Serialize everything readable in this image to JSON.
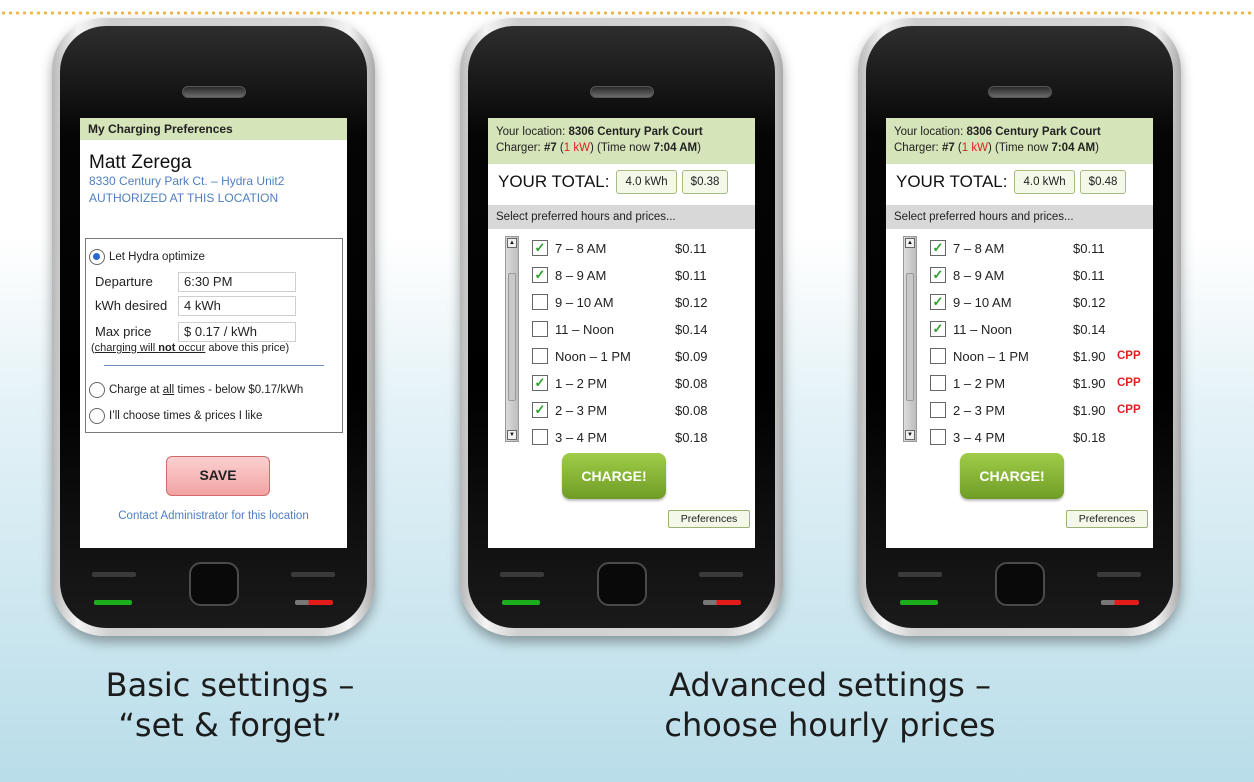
{
  "phone1": {
    "header": "My Charging Preferences",
    "user_name": "Matt Zerega",
    "address": "8330 Century Park Ct. – Hydra Unit2",
    "auth_status": "AUTHORIZED AT THIS LOCATION",
    "option_optimize": "Let Hydra optimize",
    "departure_label": "Departure",
    "departure_value": "6:30 PM",
    "kwh_label": "kWh desired",
    "kwh_value": "4 kWh",
    "maxprice_label": "Max price",
    "maxprice_value": "$ 0.17 / kWh",
    "note_part1": "charging will ",
    "note_part2": "not",
    "note_part3": " occur",
    "note_part4": " above this price)",
    "option_all_pre": "Charge at ",
    "option_all_u": "all",
    "option_all_post": " times - below $0.17/kWh",
    "option_choose": "I’ll choose times & prices I like",
    "save_label": "SAVE",
    "contact_link": "Contact Administrator for this location"
  },
  "phone2": {
    "loc_prefix": "Your location: ",
    "loc_value": "8306 Century Park Court",
    "charger_prefix": "Charger: ",
    "charger_value": "#7",
    "charger_kw": "1 kW",
    "time_prefix": "(Time now ",
    "time_value": "7:04 AM",
    "total_label": "YOUR TOTAL:",
    "total_kwh": "4.0 kWh",
    "total_price": "$0.38",
    "select_prompt": "Select preferred hours and prices...",
    "hours": [
      {
        "label": "7 – 8 AM",
        "price": "$0.11",
        "checked": true,
        "tag": ""
      },
      {
        "label": "8 – 9 AM",
        "price": "$0.11",
        "checked": true,
        "tag": ""
      },
      {
        "label": "9 – 10 AM",
        "price": "$0.12",
        "checked": false,
        "tag": ""
      },
      {
        "label": "11 – Noon",
        "price": "$0.14",
        "checked": false,
        "tag": ""
      },
      {
        "label": "Noon – 1 PM",
        "price": "$0.09",
        "checked": false,
        "tag": ""
      },
      {
        "label": "1 – 2 PM",
        "price": "$0.08",
        "checked": true,
        "tag": ""
      },
      {
        "label": "2 – 3 PM",
        "price": "$0.08",
        "checked": true,
        "tag": ""
      },
      {
        "label": "3 – 4 PM",
        "price": "$0.18",
        "checked": false,
        "tag": ""
      }
    ],
    "charge_label": "CHARGE!",
    "pref_label": "Preferences"
  },
  "phone3": {
    "loc_prefix": "Your location: ",
    "loc_value": "8306 Century Park Court",
    "charger_prefix": "Charger: ",
    "charger_value": "#7",
    "charger_kw": "1 kW",
    "time_prefix": "(Time now ",
    "time_value": "7:04 AM",
    "total_label": "YOUR TOTAL:",
    "total_kwh": "4.0 kWh",
    "total_price": "$0.48",
    "select_prompt": "Select preferred hours and prices...",
    "hours": [
      {
        "label": "7 – 8 AM",
        "price": "$0.11",
        "checked": true,
        "tag": ""
      },
      {
        "label": "8 – 9 AM",
        "price": "$0.11",
        "checked": true,
        "tag": ""
      },
      {
        "label": "9 – 10 AM",
        "price": "$0.12",
        "checked": true,
        "tag": ""
      },
      {
        "label": "11 – Noon",
        "price": "$0.14",
        "checked": true,
        "tag": ""
      },
      {
        "label": "Noon – 1 PM",
        "price": "$1.90",
        "checked": false,
        "tag": "CPP"
      },
      {
        "label": "1 – 2 PM",
        "price": "$1.90",
        "checked": false,
        "tag": "CPP"
      },
      {
        "label": "2 – 3 PM",
        "price": "$1.90",
        "checked": false,
        "tag": "CPP"
      },
      {
        "label": "3 – 4 PM",
        "price": "$0.18",
        "checked": false,
        "tag": ""
      }
    ],
    "charge_label": "CHARGE!",
    "pref_label": "Preferences"
  },
  "captions": {
    "basic_line1": "Basic settings –",
    "basic_line2": "“set & forget”",
    "advanced_line1": "Advanced settings –",
    "advanced_line2": "choose hourly prices"
  },
  "colors": {
    "header_green": "#d5e4b9",
    "link_blue": "#4f7fbf",
    "save_pink": "#f2a3a3",
    "charge_green": "#7fae2e",
    "cpp_red": "#e02020",
    "dotted_orange": "#f1b74a"
  }
}
